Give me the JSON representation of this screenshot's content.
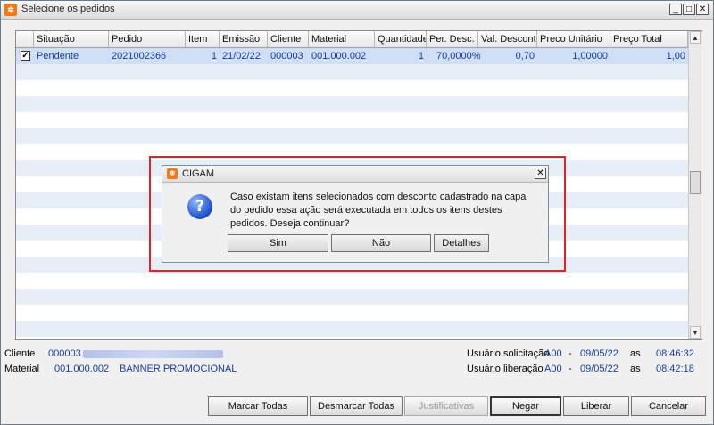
{
  "window": {
    "title": "Selecione os pedidos",
    "icon": "cigam-logo-icon"
  },
  "grid": {
    "columns": [
      "Situação",
      "Pedido",
      "Item",
      "Emissão",
      "Cliente",
      "Material",
      "Quantidade",
      "Per. Desc.",
      "Val. Desconto",
      "Preco Unitário",
      "Preço Total"
    ],
    "rows": [
      {
        "checked": true,
        "situacao": "Pendente",
        "pedido": "2021002366",
        "item": "1",
        "emissao": "21/02/22",
        "cliente": "000003",
        "material": "001.000.002",
        "quantidade": "1",
        "per_desc": "70,0000%",
        "val_desconto": "0,70",
        "preco_unitario": "1,00000",
        "preco_total": "1,00"
      }
    ],
    "check_mark": "✓"
  },
  "dialog": {
    "title": "CIGAM",
    "message": "Caso existam itens selecionados com desconto cadastrado na capa do pedido essa ação será executada em todos os itens destes pedidos. Deseja continuar?",
    "buttons": {
      "sim": "Sim",
      "nao": "Não",
      "detalhes": "Detalhes"
    },
    "icon": "question-icon",
    "close": "✕"
  },
  "info": {
    "cliente_label": "Cliente",
    "cliente_code": "000003",
    "material_label": "Material",
    "material_code": "001.000.002",
    "material_name": "BANNER PROMOCIONAL",
    "usuario_solicitacao_label": "Usuário solicitação",
    "usuario_solicitacao_user": "A00",
    "usuario_solicitacao_date": "09/05/22",
    "usuario_solicitacao_time": "08:46:32",
    "usuario_liberacao_label": "Usuário liberação",
    "usuario_liberacao_user": "A00",
    "usuario_liberacao_date": "09/05/22",
    "usuario_liberacao_time": "08:42:18",
    "sep": "-",
    "as": "as"
  },
  "buttons": {
    "marcar_todas": "Marcar Todas",
    "desmarcar_todas": "Desmarcar Todas",
    "justificativas": "Justificativas",
    "negar": "Negar",
    "liberar": "Liberar",
    "cancelar": "Cancelar"
  },
  "window_controls": {
    "minimize": "_",
    "maximize": "□",
    "close": "✕"
  },
  "colors": {
    "accent_border": "#e02424",
    "text_blue": "#1a3b9a",
    "selected_row": "#cfdff5"
  }
}
